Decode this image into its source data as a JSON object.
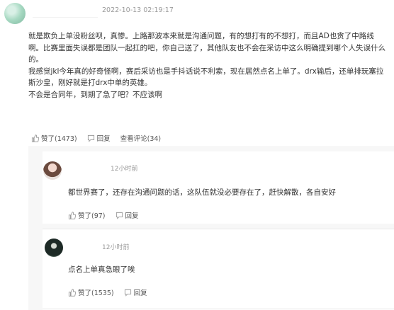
{
  "post": {
    "timestamp": "2022-10-13 02:19:17",
    "lines": [
      "就是欺负上单没粉丝呗，真惨。上路那波本来就是沟通问题，有的想打有的不想打，而且AD也贪了中路线",
      "啊。比赛里面失误都是团队一起扛的吧，你自己送了，其他队友也不会在采访中这么明确提到哪个人失误什么",
      "的。",
      "我感觉jkl今年真的好奇怪啊，赛后采访也是手抖话说不利索，现在居然点名上单了。drx输后，还单排玩塞拉",
      "斯沙皇，刚好就是打drx中单的英雄。",
      "不会是合同年，到期了急了吧？不应该啊"
    ],
    "like_label": "赞了(1473)",
    "reply_label": "回复",
    "view_replies_label": "查看评论(34)"
  },
  "replies": [
    {
      "time": "12小时前",
      "text": "都世界赛了，还存在沟通问题的话，这队伍就没必要存在了，赶快解散，各自安好",
      "like_label": "赞了(97)",
      "reply_label": "回复"
    },
    {
      "time": "12小时前",
      "text": "点名上单真急眼了唉",
      "like_label": "赞了(1535)",
      "reply_label": "回复"
    }
  ],
  "icons": {
    "like": "thumbs-up-icon",
    "reply": "comment-icon",
    "user": "avatar"
  },
  "colors": {
    "text": "#333333",
    "meta": "#9a9a9a",
    "panel": "#f7f7f7"
  }
}
